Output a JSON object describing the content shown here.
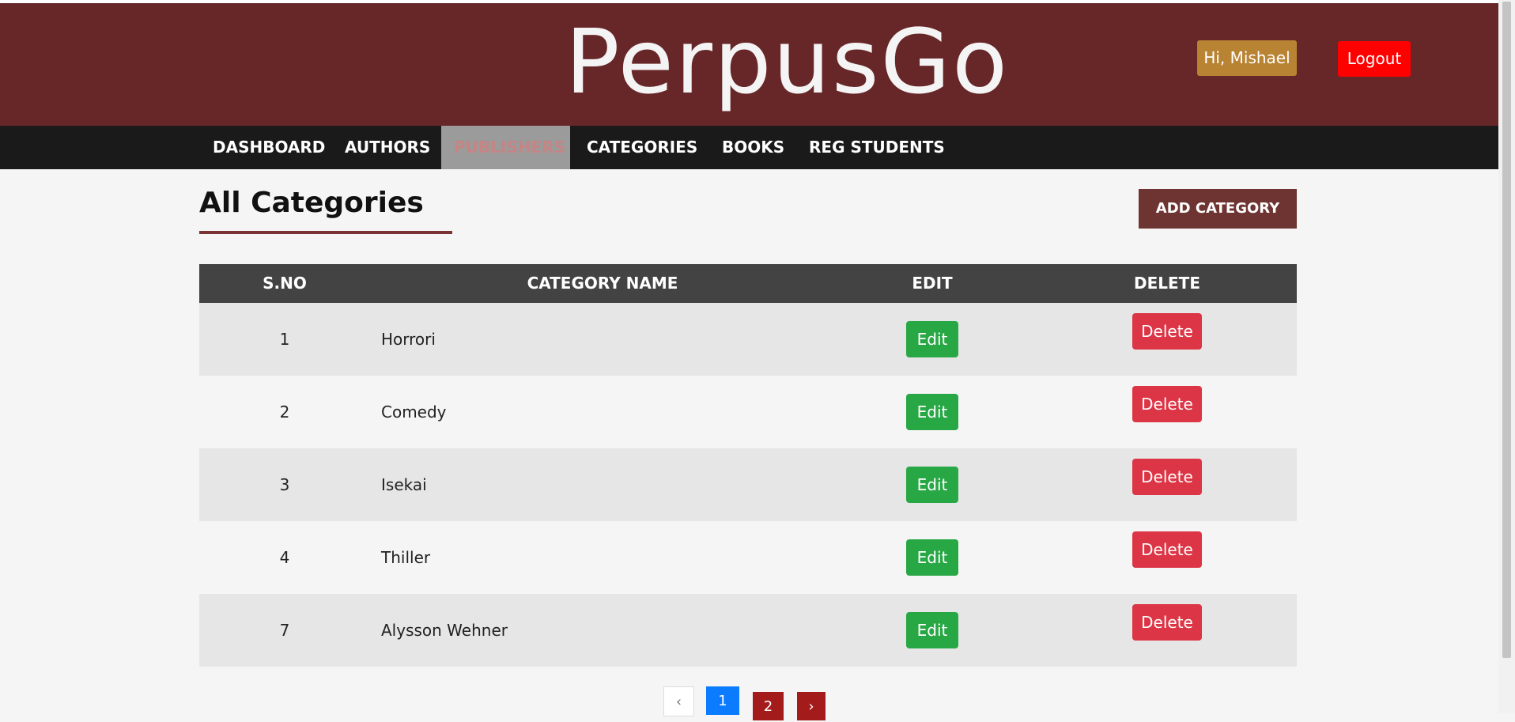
{
  "header": {
    "logo": "PerpusGo",
    "greeting": "Hi, Mishael",
    "logout_label": "Logout"
  },
  "nav": {
    "items": [
      {
        "label": "DASHBOARD"
      },
      {
        "label": "AUTHORS"
      },
      {
        "label": "PUBLISHERS"
      },
      {
        "label": "CATEGORIES"
      },
      {
        "label": "BOOKS"
      },
      {
        "label": "REG STUDENTS"
      }
    ]
  },
  "main": {
    "title": "All Categories",
    "add_button": "ADD CATEGORY",
    "table": {
      "headers": [
        "S.NO",
        "CATEGORY NAME",
        "EDIT",
        "DELETE"
      ],
      "rows": [
        {
          "sno": "1",
          "name": "Horrori",
          "edit": "Edit",
          "delete": "Delete"
        },
        {
          "sno": "2",
          "name": "Comedy",
          "edit": "Edit",
          "delete": "Delete"
        },
        {
          "sno": "3",
          "name": "Isekai",
          "edit": "Edit",
          "delete": "Delete"
        },
        {
          "sno": "4",
          "name": "Thiller",
          "edit": "Edit",
          "delete": "Delete"
        },
        {
          "sno": "7",
          "name": "Alysson Wehner",
          "edit": "Edit",
          "delete": "Delete"
        }
      ]
    }
  },
  "pagination": {
    "prev": "‹",
    "pages": [
      "1",
      "2"
    ],
    "next": "›",
    "current": "1"
  },
  "colors": {
    "header_bg": "#672628",
    "nav_bg": "#1a1a1a",
    "edit_btn": "#28a745",
    "delete_btn": "#dc3545",
    "add_btn": "#6e3432"
  }
}
